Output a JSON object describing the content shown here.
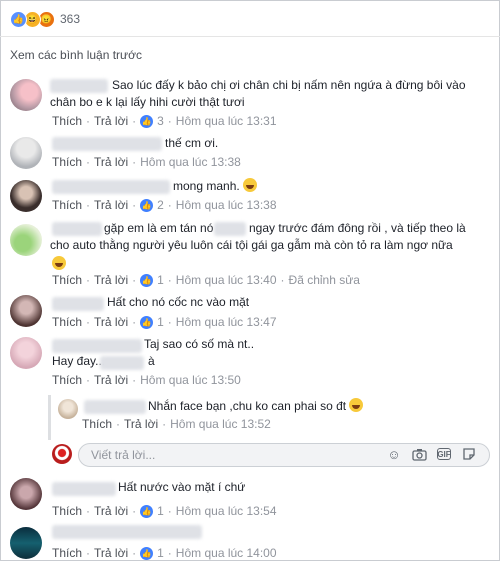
{
  "reactions": {
    "count": "363"
  },
  "prev_link": "Xem các bình luận trước",
  "comments": [
    {
      "text": [
        "Sao lúc đấy k bảo chị ơi chân chi bị nấm nên ngứa à đừng bôi vào",
        "chân bo e k lại lấy hihi cười thật tươi"
      ],
      "like": "Thích",
      "reply": "Trả lời",
      "likes": "3",
      "time": "Hôm qua lúc 13:31"
    },
    {
      "text": [
        "thế cm ơi."
      ],
      "like": "Thích",
      "reply": "Trả lời",
      "likes": "",
      "time": "Hôm qua lúc 13:38"
    },
    {
      "text": [
        "mong manh."
      ],
      "like": "Thích",
      "reply": "Trả lời",
      "likes": "2",
      "time": "Hôm qua lúc 13:38"
    },
    {
      "text": [
        "gặp em là em tán nó",
        "ngay trước đám đông rồi , và tiếp theo là",
        "cho auto thằng người yêu luôn cái tội gái ga gẫm mà còn tỏ ra làm ngơ nữa"
      ],
      "like": "Thích",
      "reply": "Trả lời",
      "likes": "1",
      "time": "Hôm qua lúc 13:40",
      "edited": "Đã chỉnh sửa"
    },
    {
      "text": [
        "Hất cho nó cốc nc vào mặt"
      ],
      "like": "Thích",
      "reply": "Trả lời",
      "likes": "1",
      "time": "Hôm qua lúc 13:47"
    },
    {
      "text": [
        "Taj sao có số mà nt..",
        "Hay đay...",
        "à"
      ],
      "like": "Thích",
      "reply": "Trả lời",
      "likes": "",
      "time": "Hôm qua lúc 13:50"
    },
    {
      "text": [
        "Nhắn face bạn ,chu ko can phai so đt"
      ],
      "like": "Thích",
      "reply": "Trả lời",
      "likes": "",
      "time": "Hôm qua lúc 13:52"
    },
    {
      "text": [
        "Hất nước vào mặt í chứ"
      ],
      "like": "Thích",
      "reply": "Trả lời",
      "likes": "1",
      "time": "Hôm qua lúc 13:54"
    },
    {
      "text": [],
      "like": "Thích",
      "reply": "Trả lời",
      "likes": "1",
      "time": "Hôm qua lúc 14:00"
    }
  ],
  "composer": {
    "placeholder": "Viết trả lời..."
  },
  "icons": [
    "like-icon",
    "haha-icon",
    "angry-icon",
    "emoji-icon",
    "camera-icon",
    "gif-icon",
    "sticker-icon"
  ],
  "colors": {
    "accent": "#4080ff",
    "link": "#4b4f56",
    "meta": "#90949c"
  }
}
